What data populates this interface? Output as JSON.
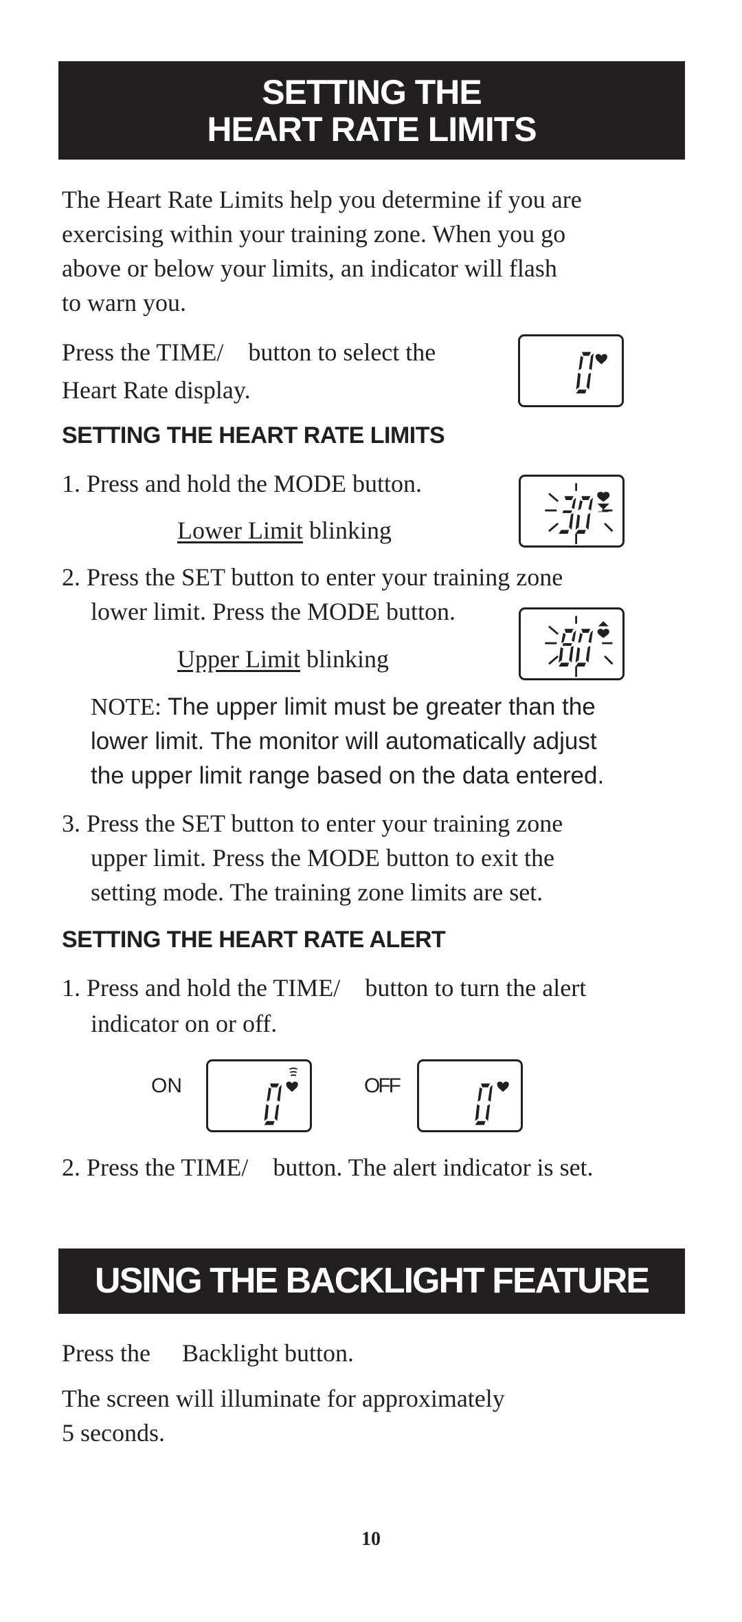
{
  "section1": {
    "title_line1": "SETTING THE",
    "title_line2": "HEART RATE LIMITS",
    "intro": [
      "The Heart Rate Limits help you determine if you are",
      "exercising within your training zone. When you go",
      "above or below your limits, an indicator will flash",
      "to warn you."
    ],
    "select_display": {
      "line1_pre": "Press the TIME/",
      "line1_post": "button to select the",
      "line2": "Heart Rate display.",
      "lcd_digit": "0",
      "lcd_icon": "heart-icon"
    }
  },
  "limits": {
    "heading": "SETTING THE HEART RATE LIMITS",
    "step1": "1. Press and hold the MODE button.",
    "step1_caption_underlined": "Lower Limit",
    "step1_caption_rest": " blinking",
    "step1_lcd_value": "30",
    "step2_line1": "2. Press the SET button to enter your training zone",
    "step2_line2": "lower limit. Press the MODE button.",
    "step2_caption_underlined": "Upper Limit",
    "step2_caption_rest": " blinking",
    "step2_lcd_value": "80",
    "note_label": "NOTE:",
    "note_line1": " The upper limit must be greater than the",
    "note_line2": "lower limit. The monitor will automatically adjust",
    "note_line3": "the upper limit range based on the data entered.",
    "step3_line1": "3. Press the SET button to enter your training zone",
    "step3_line2": "upper limit. Press the MODE button to exit the",
    "step3_line3": "setting mode. The training zone limits are set."
  },
  "alert": {
    "heading": "SETTING THE HEART RATE ALERT",
    "step1_line1_pre": "1. Press and hold the TIME/",
    "step1_line1_post": "button to turn the alert",
    "step1_line2": "indicator on or off.",
    "on_label": "ON",
    "off_label": "OFF",
    "on_lcd_digit": "0",
    "off_lcd_digit": "0",
    "step2_pre": "2. Press the TIME/",
    "step2_post": "button. The alert indicator is set."
  },
  "section2": {
    "title": "USING THE BACKLIGHT FEATURE",
    "line1_pre": "Press the",
    "line1_post": "Backlight button.",
    "line2": "The screen will illuminate for approximately",
    "line3": "5 seconds."
  },
  "page_number": "10"
}
